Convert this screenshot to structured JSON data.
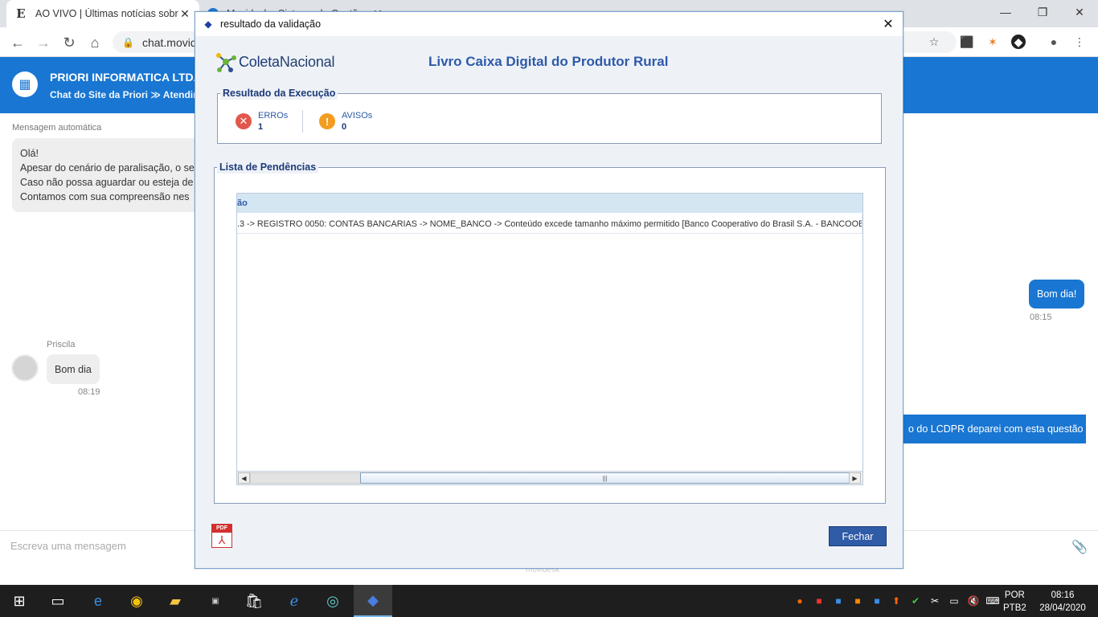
{
  "browser": {
    "tabs": [
      {
        "label": "AO VIVO | Últimas notícias sobre",
        "favicon": "E"
      },
      {
        "label": "Movidesk - Sistema de Gestão"
      }
    ],
    "url": "chat.movid"
  },
  "chat": {
    "company": "PRIORI INFORMATICA LTDA",
    "breadcrumb": "Chat do Site da Priori ≫ Atendim",
    "auto_label": "Mensagem automática",
    "bot_lines": [
      "Olá!",
      "Apesar do cenário de paralisação, o se",
      "Caso não possa aguardar ou esteja de",
      "Contamos com sua compreensão nes"
    ],
    "user_msg1": "Bom dia!",
    "user_time1": "08:15",
    "agent_name": "Priscila",
    "agent_msg": "Bom dia",
    "agent_time": "08:19",
    "user_msg2": "o do LCDPR deparei com esta questão",
    "compose_placeholder": "Escreva uma mensagem",
    "powered": "movidesk"
  },
  "dialog": {
    "title": "resultado da validação",
    "logo_text_a": "Coleta",
    "logo_text_b": "Nacional",
    "app_title": "Livro Caixa Digital do Produtor Rural",
    "result_legend": "Resultado da Execução",
    "errors_label": "ERROs",
    "errors_value": "1",
    "warnings_label": "AVISOs",
    "warnings_value": "0",
    "pending_legend": "Lista de Pendências",
    "grid_header": "ão",
    "grid_rows": [
      ".3 -> REGISTRO 0050: CONTAS BANCARIAS -> NOME_BANCO -> Conteúdo excede tamanho máximo permitido [Banco Cooperativo do Brasil S.A. - BANCOOB]"
    ],
    "close_button": "Fechar",
    "pdf_label": "PDF"
  },
  "taskbar": {
    "lang_top": "POR",
    "lang_bottom": "PTB2",
    "time": "08:16",
    "date": "28/04/2020"
  },
  "colors": {
    "chat_blue": "#1976d2",
    "dialog_accent": "#2e5aa8",
    "error": "#e2574c",
    "warning": "#f39c1f"
  }
}
